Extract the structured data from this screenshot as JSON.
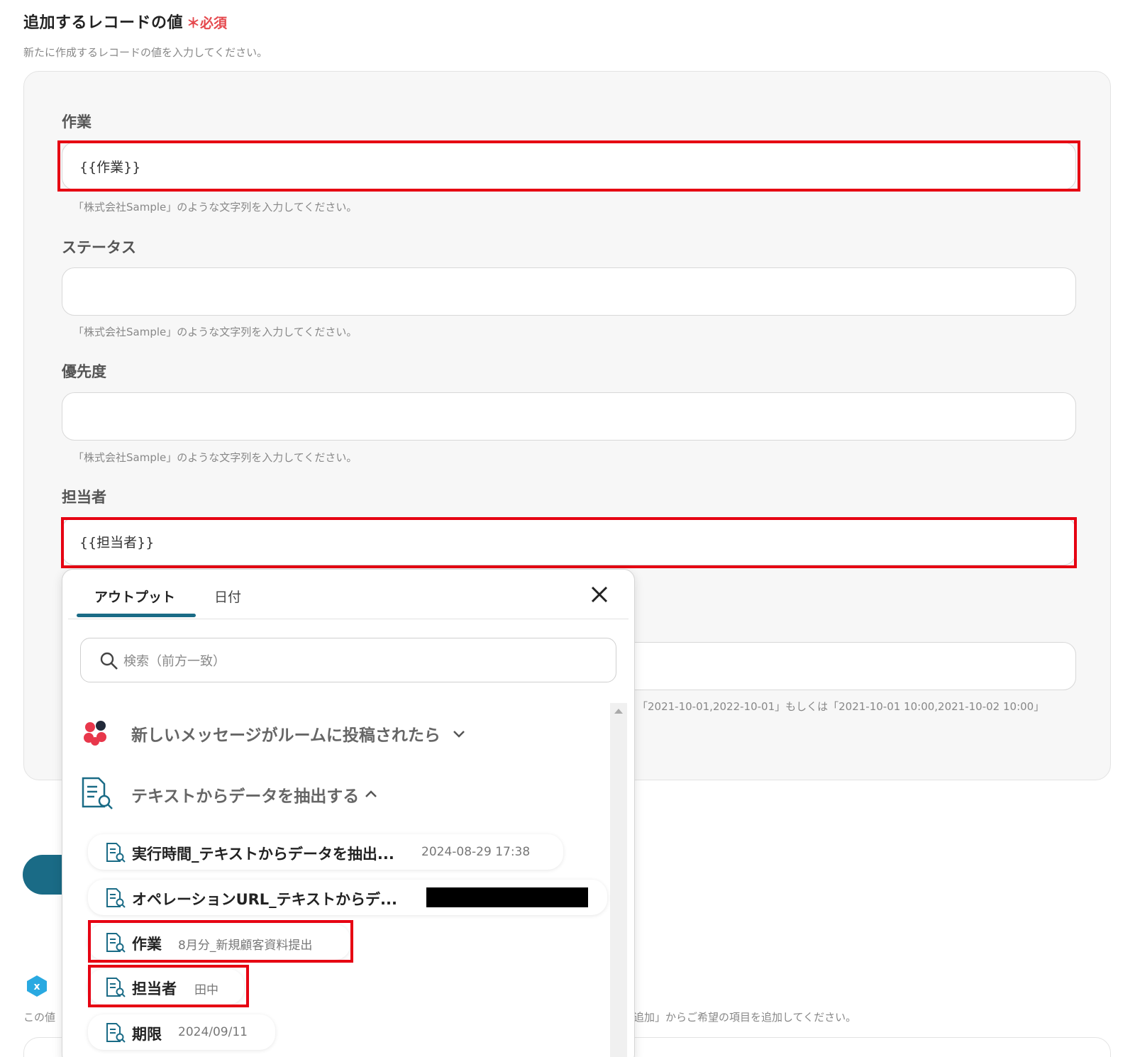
{
  "section": {
    "title": "追加するレコードの値",
    "required": "＊必須",
    "description": "新たに作成するレコードの値を入力してください。"
  },
  "fields": [
    {
      "label": "作業",
      "value": "{{作業}}",
      "hint": "「株式会社Sample」のような文字列を入力してください。"
    },
    {
      "label": "ステータス",
      "value": "",
      "hint": "「株式会社Sample」のような文字列を入力してください。"
    },
    {
      "label": "優先度",
      "value": "",
      "hint": "「株式会社Sample」のような文字列を入力してください。"
    },
    {
      "label": "担当者",
      "value": "{{担当者}}",
      "hint": ""
    }
  ],
  "date_field": {
    "hint": "「2021-10-01,2022-10-01」もしくは「2021-10-01 10:00,2021-10-02 10:00」"
  },
  "background": {
    "lower_desc_left": "この値",
    "lower_desc_right": "追加」からご希望の項目を追加してください。"
  },
  "dropdown": {
    "tabs": [
      "アウトプット",
      "日付"
    ],
    "search_placeholder": "検索（前方一致）",
    "groups": [
      {
        "title": "新しいメッセージがルームに投稿されたら",
        "icon": "chatwork-logo-icon",
        "expanded": false
      },
      {
        "title": "テキストからデータを抽出する",
        "icon": "document-search-icon",
        "expanded": true
      }
    ],
    "items": [
      {
        "name": "実行時間_テキストからデータを抽出...",
        "value": "2024-08-29 17:38"
      },
      {
        "name": "オペレーションURL_テキストからデ...",
        "value": ""
      },
      {
        "name": "作業",
        "value": "8月分_新規顧客資料提出"
      },
      {
        "name": "担当者",
        "value": "田中"
      },
      {
        "name": "期限",
        "value": "2024/09/11"
      }
    ]
  },
  "colors": {
    "accent": "#1a6b86",
    "highlight": "#e60012",
    "required": "#e5484d"
  }
}
